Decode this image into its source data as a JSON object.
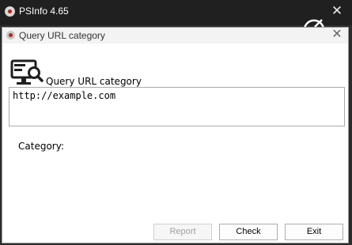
{
  "parent_window": {
    "title": "PSInfo 4.65",
    "close_glyph": "✕"
  },
  "dialog": {
    "title": "Query URL category",
    "close_glyph": "✕",
    "heading": "Query URL category",
    "url_value": "http://example.com",
    "category_label": "Category:",
    "buttons": {
      "report": "Report",
      "check": "Check",
      "exit": "Exit"
    }
  },
  "colors": {
    "accent": "#b3261e",
    "icon_dark": "#1f1f1f"
  },
  "icons": [
    "app-logo-icon",
    "close-icon",
    "query-url-icon",
    "magnifier-icon"
  ]
}
